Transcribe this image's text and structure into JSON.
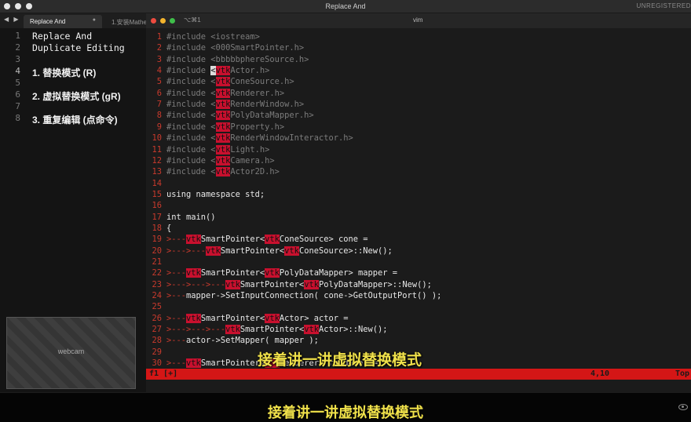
{
  "window": {
    "title": "Replace And",
    "unregistered": "UNREGISTERED"
  },
  "tabs": {
    "nav": "◀ ▶",
    "active": {
      "label": "Replace And",
      "close": "●"
    },
    "inactive": {
      "label": "1.安装Mathe"
    }
  },
  "vim": {
    "shortcut": "⌥⌘1",
    "name": "vim",
    "dots": [
      "#ed4b3f",
      "#f4b42d",
      "#3fbf4a"
    ]
  },
  "sidebar": {
    "lines": [
      {
        "n": "1",
        "text": "Replace And"
      },
      {
        "n": "2",
        "text": "Duplicate Editing"
      },
      {
        "n": "3",
        "text": ""
      },
      {
        "n": "4",
        "text": "1. 替换模式  (R)"
      },
      {
        "n": "5",
        "text": ""
      },
      {
        "n": "6",
        "text": "2. 虚拟替换模式  (gR)"
      },
      {
        "n": "7",
        "text": ""
      },
      {
        "n": "8",
        "text": "3. 重复编辑  (点命令)"
      }
    ]
  },
  "code": {
    "lines": [
      {
        "n": "1",
        "seg": [
          [
            "pp",
            "#include <iostream>"
          ]
        ]
      },
      {
        "n": "2",
        "seg": [
          [
            "pp",
            "#include <000SmartPointer.h>"
          ]
        ]
      },
      {
        "n": "3",
        "seg": [
          [
            "pp",
            "#include <bbbbbphereSource.h>"
          ]
        ]
      },
      {
        "n": "4",
        "seg": [
          [
            "pp",
            "#include "
          ],
          [
            "cur",
            "<"
          ],
          [
            "hl",
            "vtk"
          ],
          [
            "pp",
            "Actor.h>"
          ]
        ]
      },
      {
        "n": "5",
        "seg": [
          [
            "pp",
            "#include <"
          ],
          [
            "hl",
            "vtk"
          ],
          [
            "pp",
            "ConeSource.h>"
          ]
        ]
      },
      {
        "n": "6",
        "seg": [
          [
            "pp",
            "#include <"
          ],
          [
            "hl",
            "vtk"
          ],
          [
            "pp",
            "Renderer.h>"
          ]
        ]
      },
      {
        "n": "7",
        "seg": [
          [
            "pp",
            "#include <"
          ],
          [
            "hl",
            "vtk"
          ],
          [
            "pp",
            "RenderWindow.h>"
          ]
        ]
      },
      {
        "n": "8",
        "seg": [
          [
            "pp",
            "#include <"
          ],
          [
            "hl",
            "vtk"
          ],
          [
            "pp",
            "PolyDataMapper.h>"
          ]
        ]
      },
      {
        "n": "9",
        "seg": [
          [
            "pp",
            "#include <"
          ],
          [
            "hl",
            "vtk"
          ],
          [
            "pp",
            "Property.h>"
          ]
        ]
      },
      {
        "n": "10",
        "seg": [
          [
            "pp",
            "#include <"
          ],
          [
            "hl",
            "vtk"
          ],
          [
            "pp",
            "RenderWindowInteractor.h>"
          ]
        ]
      },
      {
        "n": "11",
        "seg": [
          [
            "pp",
            "#include <"
          ],
          [
            "hl",
            "vtk"
          ],
          [
            "pp",
            "Light.h>"
          ]
        ]
      },
      {
        "n": "12",
        "seg": [
          [
            "pp",
            "#include <"
          ],
          [
            "hl",
            "vtk"
          ],
          [
            "pp",
            "Camera.h>"
          ]
        ]
      },
      {
        "n": "13",
        "seg": [
          [
            "pp",
            "#include <"
          ],
          [
            "hl",
            "vtk"
          ],
          [
            "pp",
            "Actor2D.h>"
          ]
        ]
      },
      {
        "n": "14",
        "seg": []
      },
      {
        "n": "15",
        "seg": [
          [
            "tx",
            "using namespace std;"
          ]
        ]
      },
      {
        "n": "16",
        "seg": []
      },
      {
        "n": "17",
        "seg": [
          [
            "tx",
            "int main()"
          ]
        ]
      },
      {
        "n": "18",
        "seg": [
          [
            "tx",
            "{"
          ]
        ]
      },
      {
        "n": "19",
        "seg": [
          [
            "ind",
            ">---"
          ],
          [
            "hl",
            "vtk"
          ],
          [
            "tx",
            "SmartPointer<"
          ],
          [
            "hl",
            "vtk"
          ],
          [
            "tx",
            "ConeSource> cone ="
          ]
        ]
      },
      {
        "n": "20",
        "seg": [
          [
            "ind",
            ">--->---"
          ],
          [
            "hl",
            "vtk"
          ],
          [
            "tx",
            "SmartPointer<"
          ],
          [
            "hl",
            "vtk"
          ],
          [
            "tx",
            "ConeSource>::New();"
          ]
        ]
      },
      {
        "n": "21",
        "seg": []
      },
      {
        "n": "22",
        "seg": [
          [
            "ind",
            ">---"
          ],
          [
            "hl",
            "vtk"
          ],
          [
            "tx",
            "SmartPointer<"
          ],
          [
            "hl",
            "vtk"
          ],
          [
            "tx",
            "PolyDataMapper> mapper ="
          ]
        ]
      },
      {
        "n": "23",
        "seg": [
          [
            "ind",
            ">--->--->---"
          ],
          [
            "hl",
            "vtk"
          ],
          [
            "tx",
            "SmartPointer<"
          ],
          [
            "hl",
            "vtk"
          ],
          [
            "tx",
            "PolyDataMapper>::New();"
          ]
        ]
      },
      {
        "n": "24",
        "seg": [
          [
            "ind",
            ">---"
          ],
          [
            "tx",
            "mapper->SetInputConnection( cone->GetOutputPort() );"
          ]
        ]
      },
      {
        "n": "25",
        "seg": []
      },
      {
        "n": "26",
        "seg": [
          [
            "ind",
            ">---"
          ],
          [
            "hl",
            "vtk"
          ],
          [
            "tx",
            "SmartPointer<"
          ],
          [
            "hl",
            "vtk"
          ],
          [
            "tx",
            "Actor> actor ="
          ]
        ]
      },
      {
        "n": "27",
        "seg": [
          [
            "ind",
            ">--->--->---"
          ],
          [
            "hl",
            "vtk"
          ],
          [
            "tx",
            "SmartPointer<"
          ],
          [
            "hl",
            "vtk"
          ],
          [
            "tx",
            "Actor>::New();"
          ]
        ]
      },
      {
        "n": "28",
        "seg": [
          [
            "ind",
            ">---"
          ],
          [
            "tx",
            "actor->SetMapper( mapper );"
          ]
        ]
      },
      {
        "n": "29",
        "seg": []
      },
      {
        "n": "30",
        "seg": [
          [
            "ind",
            ">---"
          ],
          [
            "hl",
            "vtk"
          ],
          [
            "tx",
            "SmartPointer<"
          ],
          [
            "hl",
            "vtk"
          ],
          [
            "tx",
            "Renderer> renderer ="
          ]
        ]
      }
    ]
  },
  "status": {
    "left": "f1 [+]",
    "pos": "4,10",
    "scroll": "Top"
  },
  "subtitle": {
    "overlay": "接着讲一讲虚拟替换模式",
    "bottom": "接着讲一讲虚拟替换模式"
  },
  "webcam": {
    "label": "webcam"
  },
  "colors": {
    "accent": "#c8102e",
    "status": "#d41616",
    "subtitle": "#f0e14a",
    "line_number": "#c93a2d"
  }
}
